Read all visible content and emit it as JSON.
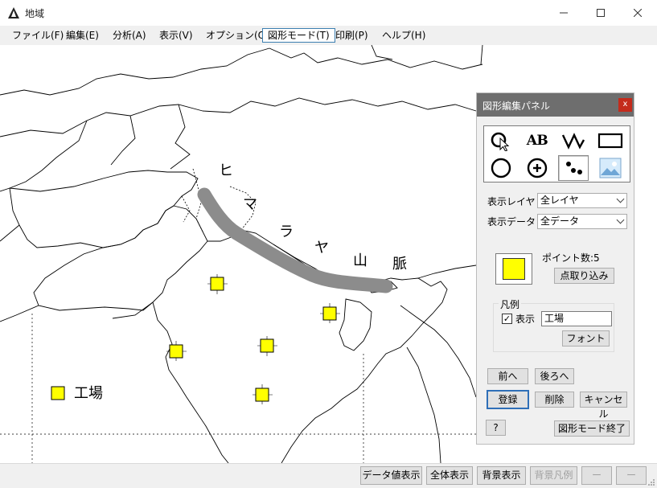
{
  "window": {
    "title": "地域",
    "minimize_icon": "minimize-icon",
    "maximize_icon": "maximize-icon",
    "close_icon": "close-icon"
  },
  "menu": [
    {
      "label": "ファイル(F)"
    },
    {
      "label": "編集(E)"
    },
    {
      "label": "分析(A)"
    },
    {
      "label": "表示(V)"
    },
    {
      "label": "オプション(O)"
    },
    {
      "label": "図形モード(T)",
      "active": true
    },
    {
      "label": "印刷(P)"
    },
    {
      "label": "ヘルプ(H)"
    }
  ],
  "map": {
    "annotation_chars": [
      "ヒ",
      "マ",
      "ラ",
      "ヤ",
      "山",
      "脈"
    ],
    "legend_label": "工場",
    "point_color": "#ffff00",
    "line_color": "#8c8c8c"
  },
  "panel": {
    "title": "図形編集パネル",
    "close_label": "x",
    "tools": [
      {
        "icon": "point-select-icon"
      },
      {
        "icon": "text-tool-icon",
        "label": "AB"
      },
      {
        "icon": "polyline-tool-icon"
      },
      {
        "icon": "rectangle-tool-icon"
      },
      {
        "icon": "circle-tool-icon"
      },
      {
        "icon": "circle-plus-tool-icon"
      },
      {
        "icon": "points-tool-icon",
        "selected": true
      },
      {
        "icon": "image-tool-icon"
      }
    ],
    "layer_label": "表示レイヤ",
    "layer_value": "全レイヤ",
    "data_label": "表示データ",
    "data_value": "全データ",
    "point_count": "ポイント数:5",
    "capture_button": "点取り込み",
    "legend_group": "凡例",
    "show_label": "表示",
    "show_checked": "✓",
    "legend_text": "工場",
    "font_button": "フォント",
    "prev_button": "前へ",
    "back_button": "後ろへ",
    "register_button": "登録",
    "delete_button": "削除",
    "cancel_button": "キャンセル",
    "help_button": "?",
    "exit_button": "図形モード終了"
  },
  "status_buttons": [
    {
      "label": "データ値表示"
    },
    {
      "label": "全体表示"
    },
    {
      "label": "背景表示"
    },
    {
      "label": "背景凡例",
      "disabled": true
    },
    {
      "label": "ー",
      "disabled": true
    },
    {
      "label": "ー",
      "disabled": true
    }
  ]
}
